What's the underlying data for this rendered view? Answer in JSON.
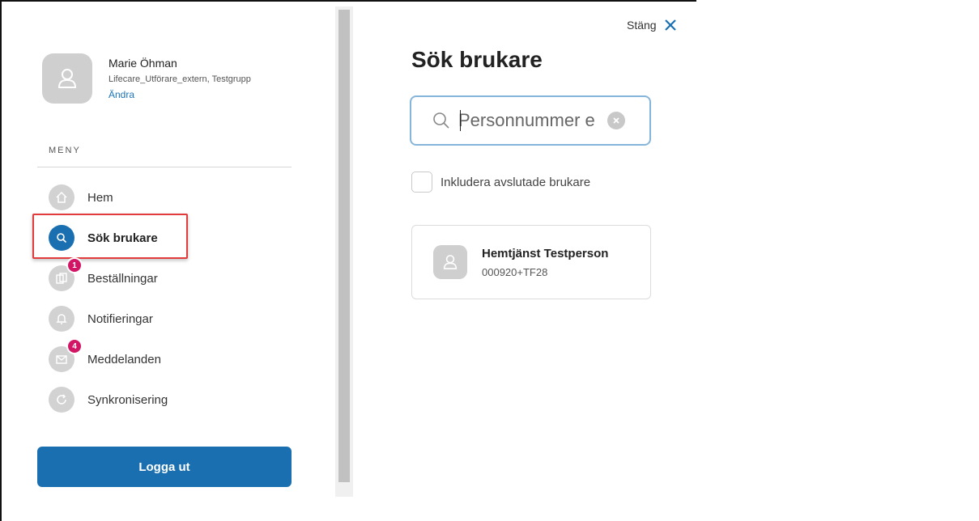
{
  "profile": {
    "name": "Marie Öhman",
    "role": "Lifecare_Utförare_extern, Testgrupp",
    "change_link": "Ändra"
  },
  "menu": {
    "heading": "MENY",
    "items": [
      {
        "label": "Hem",
        "icon": "home-icon"
      },
      {
        "label": "Sök brukare",
        "icon": "search-icon",
        "active": true
      },
      {
        "label": "Beställningar",
        "icon": "orders-icon",
        "badge": "1"
      },
      {
        "label": "Notifieringar",
        "icon": "bell-icon"
      },
      {
        "label": "Meddelanden",
        "icon": "mail-icon",
        "badge": "4"
      },
      {
        "label": "Synkronisering",
        "icon": "sync-icon"
      }
    ]
  },
  "logout_label": "Logga ut",
  "header": {
    "close_label": "Stäng",
    "title": "Sök brukare"
  },
  "search": {
    "placeholder": "Personnummer e",
    "value": ""
  },
  "include_finished": {
    "label": "Inkludera avslutade brukare",
    "checked": false
  },
  "results": [
    {
      "name": "Hemtjänst Testperson",
      "id": "000920+TF28"
    }
  ],
  "colors": {
    "accent": "#1a6fb0",
    "badge": "#d21665",
    "highlight": "#e23b3b",
    "link": "#1a73b8"
  }
}
